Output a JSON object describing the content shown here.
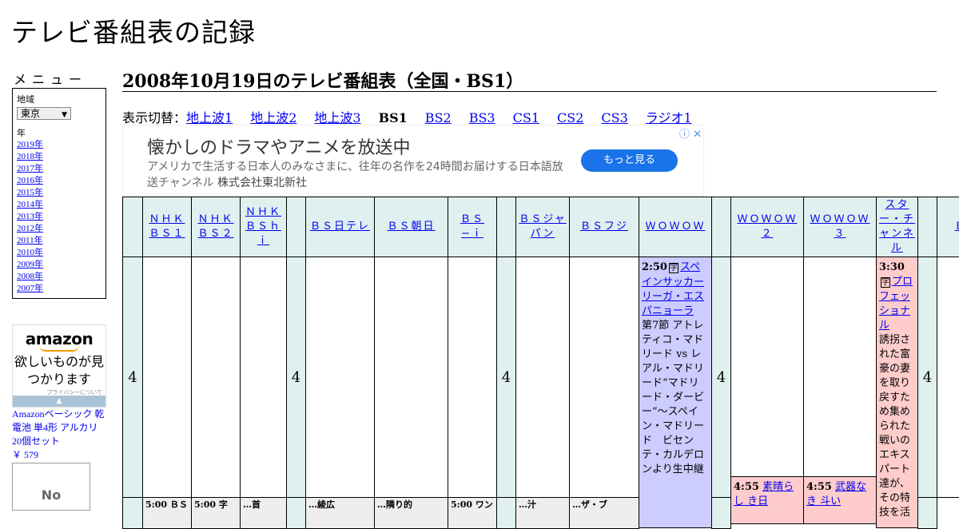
{
  "site_title": "テレビ番組表の記録",
  "sidebar": {
    "menu_heading": "メニュー",
    "region_label": "地域",
    "region_value": "東京",
    "year_label": "年",
    "years": [
      "2019年",
      "2018年",
      "2017年",
      "2016年",
      "2015年",
      "2014年",
      "2013年",
      "2012年",
      "2011年",
      "2010年",
      "2009年",
      "2008年",
      "2007年"
    ]
  },
  "amazon": {
    "logo": "amazon",
    "catch": "欲しいものが見つかります",
    "privacy": "プライバシーについて",
    "product_title": "Amazonベーシック 乾電池 単4形 アルカリ 20個セット",
    "price": "￥ 579",
    "no_image": "No"
  },
  "main": {
    "page_title": "2008年10月19日のテレビ番組表（全国・BS1）",
    "switch_prefix": "表示切替：",
    "switch_items": [
      "地上波1",
      "地上波2",
      "地上波3",
      "BS1",
      "BS2",
      "BS3",
      "CS1",
      "CS2",
      "CS3",
      "ラジオ1"
    ],
    "current_switch": "BS1"
  },
  "ad": {
    "title": "懐かしのドラマやアニメを放送中",
    "desc": "アメリカで生活する日本人のみなさまに、往年の名作を24時間お届けする日本語放送チャンネル",
    "sponsor": "株式会社東北新社",
    "button": "もっと見る",
    "icons": "ⓘ ✕"
  },
  "grid": {
    "channels": [
      "ＮＨＫ ＢＳ１",
      "ＮＨＫ ＢＳ２",
      "ＮＨＫ ＢＳｈｉ",
      "ＢＳ日テレ",
      "ＢＳ朝日",
      "ＢＳ−ｉ",
      "ＢＳジャパン",
      "ＢＳフジ",
      "ＷＯＷＯＷ",
      "ＷＯＷＯＷ２",
      "ＷＯＷＯＷ３",
      "スター・チャンネル",
      "Ｂ"
    ],
    "hour": "4",
    "wowow_prog": {
      "time": "2:50",
      "icon": "字",
      "title": "スペインサッカー リーガ・エスパニョーラ",
      "desc": "第7節 アトレティコ・マドリード vs レアル・マドリード“マドリード・ダービー”～スペイン・マドリード　ビセンテ・カルデロンより生中継"
    },
    "star_prog": {
      "time": "3:30",
      "icon": "字",
      "title": "プロフェッショナル",
      "desc": "誘拐された富豪の妻を取り戻すため集められた戦いのエキスパート達が、その特技を活"
    },
    "wowow2_prog": {
      "time": "4:55",
      "title": "素晴らし き日"
    },
    "wowow3_prog": {
      "time": "4:55",
      "title": "武器なき 斗い"
    },
    "bottom_row": [
      "5:00 ＢＳ",
      "5:00 字",
      "…首",
      "…綾広",
      "…隣り的",
      "5:00 ワン",
      "…汁",
      "…ザ・ブ"
    ]
  }
}
